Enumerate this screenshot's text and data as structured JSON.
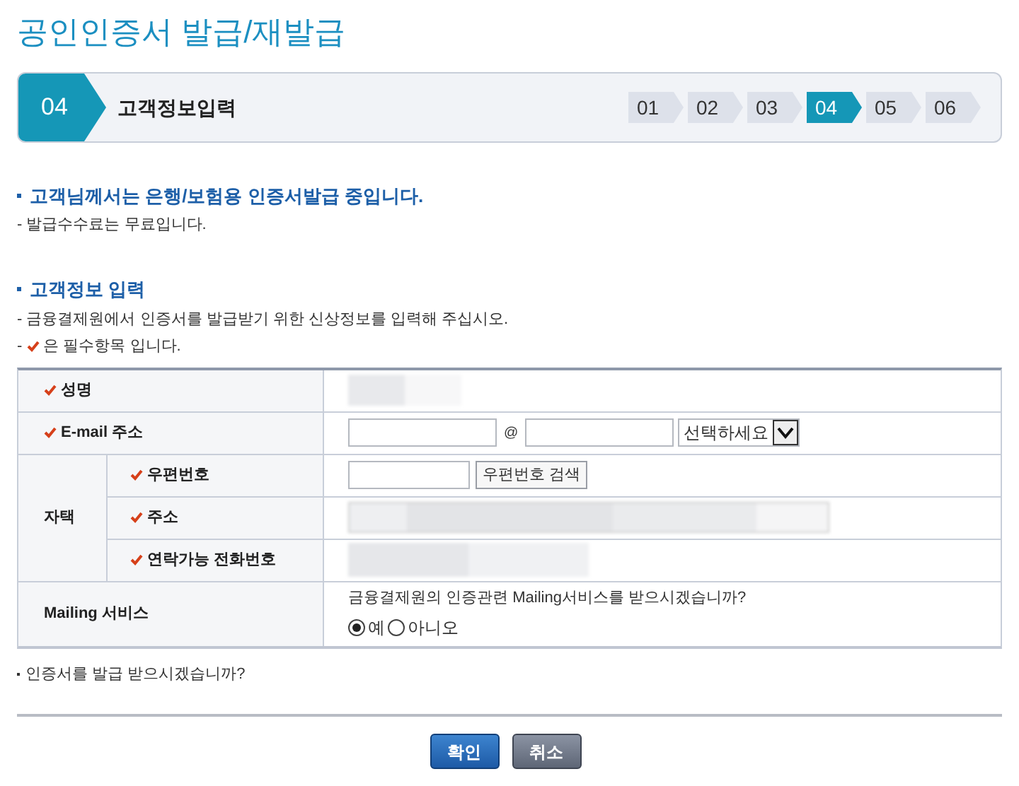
{
  "page_title": "공인인증서 발급/재발급",
  "current_step": {
    "number": "04",
    "label": "고객정보입력"
  },
  "steps": [
    {
      "label": "01",
      "selected": false
    },
    {
      "label": "02",
      "selected": false
    },
    {
      "label": "03",
      "selected": false
    },
    {
      "label": "04",
      "selected": true
    },
    {
      "label": "05",
      "selected": false
    },
    {
      "label": "06",
      "selected": false
    }
  ],
  "notice": {
    "heading": "고객님께서는 은행/보험용 인증서발급 중입니다.",
    "lines": [
      "- 발급수수료는 무료입니다."
    ]
  },
  "info_section": {
    "heading": "고객정보 입력",
    "lines": [
      "- 금융결제원에서 인증서를 발급받기 위한 신상정보를 입력해 주십시오."
    ],
    "required_prefix": "-",
    "required_note": "은 필수항목 입니다."
  },
  "form": {
    "name_label": "성명",
    "email_label": "E-mail 주소",
    "email_at": "@",
    "email_domain_select": "선택하세요",
    "home_group_label": "자택",
    "postal_label": "우편번호",
    "postal_search_button": "우편번호 검색",
    "address_label": "주소",
    "phone_label": "연락가능 전화번호",
    "mailing_label": "Mailing 서비스",
    "mailing_question": "금융결제원의 인증관련 Mailing서비스를 받으시겠습니까?",
    "mailing_options": [
      {
        "label": "예",
        "selected": true
      },
      {
        "label": "아니오",
        "selected": false
      }
    ]
  },
  "issue_question": "인증서를 발급 받으시겠습니까?",
  "buttons": [
    {
      "label": "확인",
      "kind": "primary"
    },
    {
      "label": "취소",
      "kind": "secondary"
    }
  ]
}
